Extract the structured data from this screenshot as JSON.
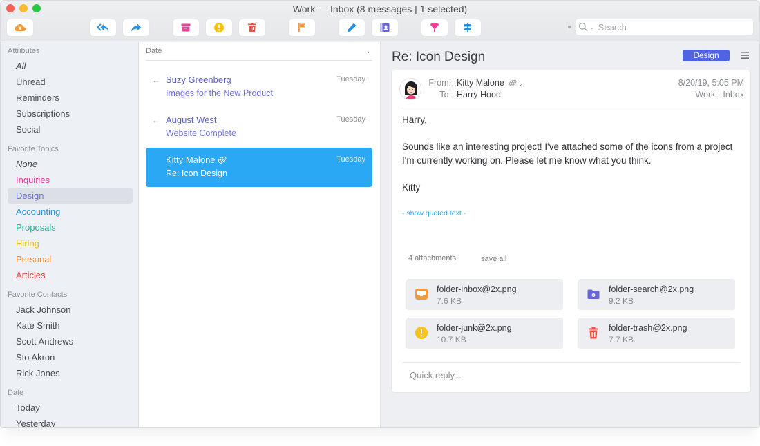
{
  "window": {
    "title": "Work — Inbox (8 messages | 1 selected)"
  },
  "toolbar": {
    "buttons": [
      {
        "name": "sync-button",
        "icon": "cloud-upload-icon",
        "color": "#f39a3a"
      },
      {
        "name": "reply-all-button",
        "icon": "reply-all-icon",
        "color": "#2a93e6"
      },
      {
        "name": "forward-button",
        "icon": "forward-icon",
        "color": "#2a93e6"
      },
      {
        "name": "archive-button",
        "icon": "archive-icon",
        "color": "#ee3f9b"
      },
      {
        "name": "junk-button",
        "icon": "exclamation-icon",
        "color": "#f7c318"
      },
      {
        "name": "delete-button",
        "icon": "trash-icon",
        "color": "#ef5043"
      },
      {
        "name": "flag-button",
        "icon": "flag-icon",
        "color": "#f39a3a"
      },
      {
        "name": "compose-button",
        "icon": "pencil-icon",
        "color": "#2a93e6"
      },
      {
        "name": "contacts-button",
        "icon": "contact-card-icon",
        "color": "#6765d8"
      },
      {
        "name": "filter-button",
        "icon": "funnel-icon",
        "color": "#ee3f9b"
      },
      {
        "name": "signpost-button",
        "icon": "signpost-icon",
        "color": "#1c95e8"
      }
    ],
    "search": {
      "placeholder": "Search",
      "value": ""
    }
  },
  "sidebar": {
    "groups": [
      {
        "heading": "Attributes",
        "items": [
          {
            "label": "All",
            "italic": true,
            "color": "#474a4f"
          },
          {
            "label": "Unread",
            "color": "#474a4f"
          },
          {
            "label": "Reminders",
            "color": "#474a4f"
          },
          {
            "label": "Subscriptions",
            "color": "#474a4f"
          },
          {
            "label": "Social",
            "color": "#474a4f"
          }
        ]
      },
      {
        "heading": "Favorite Topics",
        "items": [
          {
            "label": "None",
            "italic": true,
            "color": "#474a4f"
          },
          {
            "label": "Inquiries",
            "color": "#e9399a"
          },
          {
            "label": "Design",
            "color": "#6b70d9",
            "selected": true
          },
          {
            "label": "Accounting",
            "color": "#2a98dc"
          },
          {
            "label": "Proposals",
            "color": "#20b89a"
          },
          {
            "label": "Hiring",
            "color": "#e6c21e"
          },
          {
            "label": "Personal",
            "color": "#f08c35"
          },
          {
            "label": "Articles",
            "color": "#e8453f"
          }
        ]
      },
      {
        "heading": "Favorite Contacts",
        "items": [
          {
            "label": "Jack Johnson",
            "color": "#474a4f"
          },
          {
            "label": "Kate Smith",
            "color": "#474a4f"
          },
          {
            "label": "Scott Andrews",
            "color": "#474a4f"
          },
          {
            "label": "Sto Akron",
            "color": "#474a4f"
          },
          {
            "label": "Rick Jones",
            "color": "#474a4f"
          }
        ]
      },
      {
        "heading": "Date",
        "items": [
          {
            "label": "Today",
            "color": "#474a4f"
          },
          {
            "label": "Yesterday",
            "color": "#474a4f"
          }
        ]
      }
    ]
  },
  "list": {
    "sort_label": "Date",
    "messages": [
      {
        "from": "Suzy Greenberg",
        "subject": "Images for the New Product",
        "date": "Tuesday",
        "replied": true,
        "attachment": false,
        "selected": false
      },
      {
        "from": "August West",
        "subject": "Website Complete",
        "date": "Tuesday",
        "replied": true,
        "attachment": false,
        "selected": false
      },
      {
        "from": "Kitty Malone",
        "subject": "Re: Icon Design",
        "date": "Tuesday",
        "replied": false,
        "attachment": true,
        "selected": true
      }
    ]
  },
  "detail": {
    "subject": "Re: Icon Design",
    "tag": {
      "label": "Design",
      "color": "#5063e0"
    },
    "from_label": "From:",
    "from": "Kitty Malone",
    "to_label": "To:",
    "to": "Harry Hood",
    "date": "8/20/19, 5:05 PM",
    "mailbox": "Work - Inbox",
    "body": [
      "Harry,",
      "Sounds like an interesting project! I've attached some of the icons from a project I'm currently working on. Please let me know what you think.",
      "Kitty"
    ],
    "show_quoted": "- show quoted text -",
    "attachments_count": "4 attachments",
    "save_all": "save all",
    "attachments": [
      {
        "name": "folder-inbox@2x.png",
        "size": "7.6 KB",
        "icon": "inbox-tray-icon",
        "color": "#f39a3a"
      },
      {
        "name": "folder-search@2x.png",
        "size": "9.2 KB",
        "icon": "folder-search-icon",
        "color": "#6765d8"
      },
      {
        "name": "folder-junk@2x.png",
        "size": "10.7 KB",
        "icon": "exclamation-icon",
        "color": "#f7c318"
      },
      {
        "name": "folder-trash@2x.png",
        "size": "7.7 KB",
        "icon": "trash-icon",
        "color": "#ef5043"
      }
    ],
    "quick_reply_placeholder": "Quick reply..."
  }
}
